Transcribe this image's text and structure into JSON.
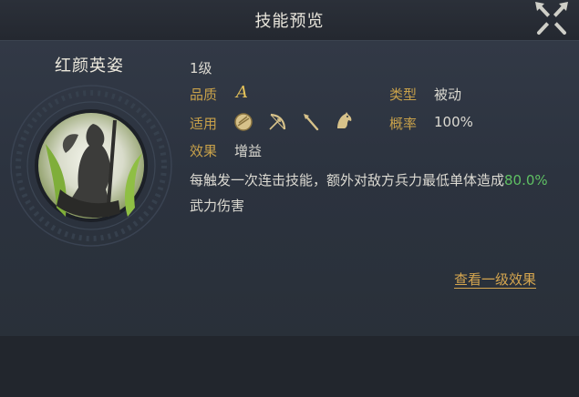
{
  "header": {
    "title": "技能预览"
  },
  "skill": {
    "name": "红颜英姿",
    "level": "1级",
    "quality_label": "品质",
    "quality_value": "A",
    "type_label": "类型",
    "type_value": "被动",
    "applicable_label": "适用",
    "applicable_units": [
      "shield-icon",
      "bow-icon",
      "spear-icon",
      "horse-icon"
    ],
    "rate_label": "概率",
    "rate_value": "100%",
    "effect_label": "效果",
    "effect_value": "增益",
    "desc_prefix": "每触发一次连击技能，额外对敌方兵力最低单体造成",
    "desc_highlight": "80.0%",
    "desc_suffix": "武力伤害"
  },
  "footer": {
    "view_level1_label": "查看一级效果"
  },
  "colors": {
    "label_gold": "#c8a14a",
    "highlight_green": "#5fc063",
    "link_gold": "#d6a64f"
  }
}
